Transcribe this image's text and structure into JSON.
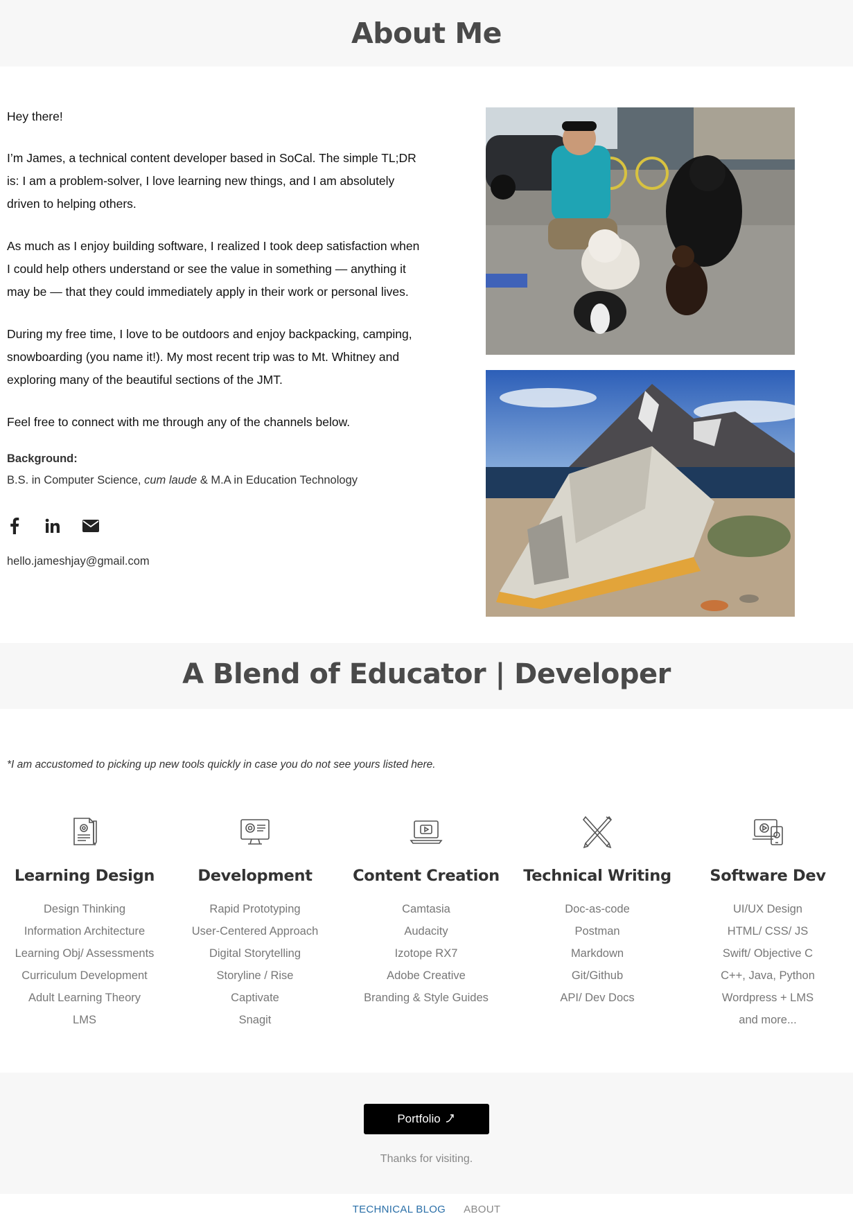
{
  "about": {
    "title": "About Me",
    "paragraphs": [
      "Hey there!",
      "I’m James, a technical content developer based in SoCal. The simple TL;DR is: I am a problem-solver, I love learning new things,  and I am absolutely driven to helping others.",
      "As much as I enjoy building software, I realized I took deep satisfaction when I could help others understand or see the value in something — anything it may be — that they could immediately apply in their work or personal lives.",
      "During my free time, I love to be outdoors and enjoy backpacking, camping, snowboarding (you name it!). My most recent trip was to Mt. Whitney and exploring many of the beautiful sections of the JMT.",
      "Feel free to connect with me through any of the channels below."
    ],
    "background_label": "Background:",
    "background_pre": "B.S. in Computer Science, ",
    "background_em": "cum laude",
    "background_post": " & M.A in Education Technology",
    "social_icons": [
      "facebook-icon",
      "linkedin-icon",
      "envelope-icon"
    ],
    "email": "hello.jameshjay@gmail.com"
  },
  "blend": {
    "title": "A Blend of Educator | Developer",
    "note": "*I am accustomed to picking up new tools quickly in case you do not see yours listed here.",
    "columns": [
      {
        "icon": "document-design-icon",
        "title": "Learning Design",
        "items": [
          "Design Thinking",
          "Information Architecture",
          "Learning Obj/ Assessments",
          "Curriculum Development",
          "Adult Learning Theory",
          "LMS"
        ]
      },
      {
        "icon": "monitor-gear-icon",
        "title": "Development",
        "items": [
          "Rapid Prototyping",
          "User-Centered Approach",
          "Digital Storytelling",
          "Storyline / Rise",
          "Captivate",
          "Snagit"
        ]
      },
      {
        "icon": "laptop-video-icon",
        "title": "Content Creation",
        "items": [
          "Camtasia",
          "Audacity",
          "Izotope RX7",
          "Adobe Creative",
          "Branding & Style Guides"
        ]
      },
      {
        "icon": "crossed-pencils-icon",
        "title": "Technical Writing",
        "items": [
          "Doc-as-code",
          "Postman",
          "Markdown",
          "Git/Github",
          "API/ Dev Docs"
        ]
      },
      {
        "icon": "devices-icon",
        "title": "Software Dev",
        "items": [
          "UI/UX Design",
          "HTML/ CSS/ JS",
          "Swift/ Objective C",
          "C++, Java, Python",
          "Wordpress + LMS",
          "and more..."
        ]
      }
    ]
  },
  "footer": {
    "portfolio_label": "Portfolio",
    "thanks": "Thanks for visiting."
  },
  "nav": {
    "blog": "TECHNICAL BLOG",
    "about": "ABOUT"
  }
}
